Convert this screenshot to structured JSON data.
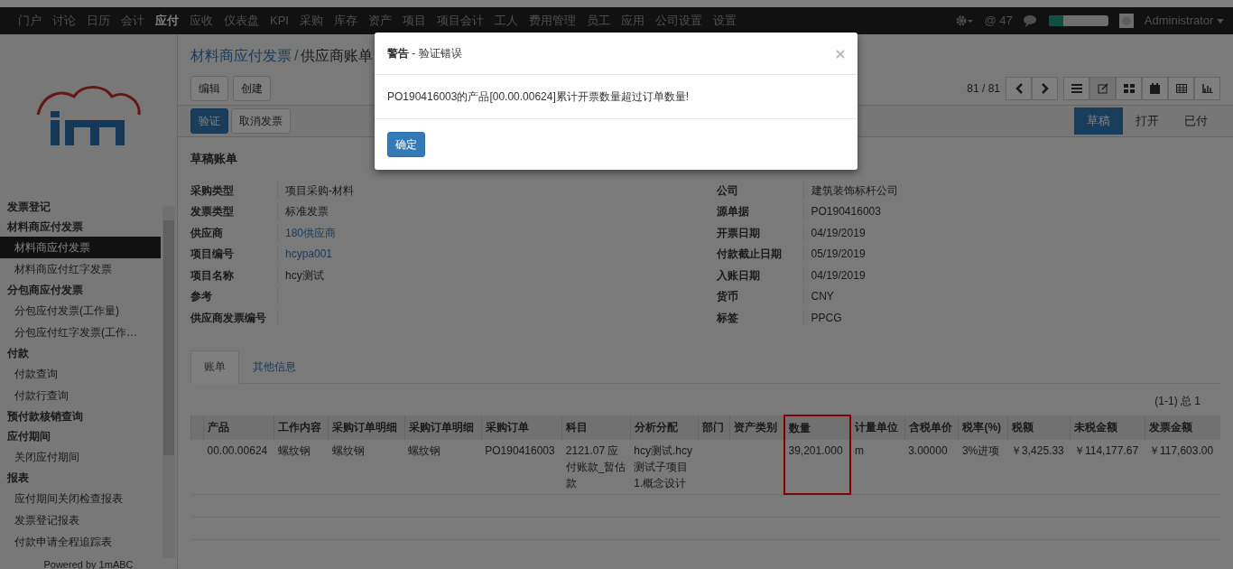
{
  "top_menu": [
    {
      "label": "门户",
      "selected": false
    },
    {
      "label": "讨论",
      "selected": false
    },
    {
      "label": "日历",
      "selected": false
    },
    {
      "label": "会计",
      "selected": false
    },
    {
      "label": "应付",
      "selected": true
    },
    {
      "label": "应收",
      "selected": false
    },
    {
      "label": "仪表盘",
      "selected": false
    },
    {
      "label": "KPI",
      "selected": false
    },
    {
      "label": "采购",
      "selected": false
    },
    {
      "label": "库存",
      "selected": false
    },
    {
      "label": "资产",
      "selected": false
    },
    {
      "label": "项目",
      "selected": false
    },
    {
      "label": "项目会计",
      "selected": false
    },
    {
      "label": "工人",
      "selected": false
    },
    {
      "label": "费用管理",
      "selected": false
    },
    {
      "label": "员工",
      "selected": false
    },
    {
      "label": "应用",
      "selected": false
    },
    {
      "label": "公司设置",
      "selected": false
    },
    {
      "label": "设置",
      "selected": false
    }
  ],
  "top_right": {
    "mentions": "@ 47",
    "progress": {
      "level": 0.25
    },
    "user": "Administrator"
  },
  "sidebar": {
    "sections": [
      {
        "title": "发票登记"
      },
      {
        "title": "材料商应付发票",
        "items": [
          {
            "label": "材料商应付发票",
            "selected": true
          },
          {
            "label": "材料商应付红字发票",
            "selected": false
          }
        ]
      },
      {
        "title": "分包商应付发票",
        "items": [
          {
            "label": "分包应付发票(工作量)",
            "selected": false
          },
          {
            "label": "分包应付红字发票(工作…",
            "selected": false
          }
        ]
      },
      {
        "title": "付款",
        "items": [
          {
            "label": "付款查询",
            "selected": false
          },
          {
            "label": "付款行查询",
            "selected": false
          }
        ]
      },
      {
        "title": "预付款核销查询"
      },
      {
        "title": "应付期间",
        "items": [
          {
            "label": "关闭应付期间",
            "selected": false
          }
        ]
      },
      {
        "title": "报表",
        "items": [
          {
            "label": "应付期间关闭检查报表",
            "selected": false
          },
          {
            "label": "发票登记报表",
            "selected": false
          },
          {
            "label": "付款申请全程追踪表",
            "selected": false
          }
        ]
      }
    ],
    "footer": "Powered by 1mABC"
  },
  "breadcrumb": {
    "items": [
      "材料商应付发票",
      "供应商账单"
    ],
    "separator": "/"
  },
  "buttons": [
    "编辑",
    "创建"
  ],
  "pager": "81 / 81",
  "action_buttons": [
    {
      "label": "验证",
      "primary": true
    },
    {
      "label": "取消发票",
      "primary": false
    }
  ],
  "status_steps": [
    {
      "label": "草稿",
      "selected": true
    },
    {
      "label": "打开",
      "selected": false
    },
    {
      "label": "已付",
      "selected": false
    }
  ],
  "form": {
    "title": "草稿账单",
    "left": [
      {
        "label": "采购类型",
        "value": "项目采购-材料",
        "link": false
      },
      {
        "label": "发票类型",
        "value": "标准发票",
        "link": false
      },
      {
        "label": "供应商",
        "value": "180供应商",
        "link": true
      },
      {
        "label": "项目编号",
        "value": "hcypa001",
        "link": true
      },
      {
        "label": "项目名称",
        "value": "hcy测试",
        "link": false
      },
      {
        "label": "参考"
      },
      {
        "label": "供应商发票编号"
      }
    ],
    "right": [
      {
        "label": "公司",
        "value": "建筑装饰标杆公司"
      },
      {
        "label": "源单据",
        "value": "PO190416003"
      },
      {
        "label": "开票日期",
        "value": "04/19/2019"
      },
      {
        "label": "付款截止日期",
        "value": "05/19/2019"
      },
      {
        "label": "入账日期",
        "value": "04/19/2019"
      },
      {
        "label": "货币",
        "value": "CNY"
      },
      {
        "label": "标签",
        "value": "PPCG"
      }
    ]
  },
  "tabs": [
    {
      "label": "账单",
      "selected": true
    },
    {
      "label": "其他信息",
      "selected": false
    }
  ],
  "table": {
    "count": "(1-1) 总 1",
    "columns": [
      {
        "label": "产品",
        "highlighted": false
      },
      {
        "label": "工作内容",
        "highlighted": false
      },
      {
        "label": "采购订单明细",
        "highlighted": false
      },
      {
        "label": "采购订单明细",
        "highlighted": false
      },
      {
        "label": "采购订单",
        "highlighted": false
      },
      {
        "label": "科目",
        "highlighted": false
      },
      {
        "label": "分析分配",
        "highlighted": false
      },
      {
        "label": "部门",
        "highlighted": false
      },
      {
        "label": "资产类别",
        "highlighted": false
      },
      {
        "label": "数量",
        "highlighted": true
      },
      {
        "label": "计量单位",
        "highlighted": false
      },
      {
        "label": "含税单价",
        "highlighted": false
      },
      {
        "label": "税率(%)",
        "highlighted": false
      },
      {
        "label": "税额",
        "highlighted": false
      },
      {
        "label": "未税金额",
        "highlighted": false
      },
      {
        "label": "发票金额",
        "highlighted": false
      }
    ],
    "rows": [
      [
        "00.00.00624",
        "螺纹钢",
        "螺纹钢",
        "螺纹钢",
        "PO190416003",
        "2121.07 应付账款_暂估款",
        "hcy测试.hcy测试子项目1.概念设计",
        "",
        "",
        "39,201.000",
        "m",
        "3.00000",
        "3%进项",
        "￥3,425.33",
        "￥114,177.67",
        "￥117,603.00"
      ]
    ]
  },
  "dialog": {
    "title": "警告",
    "subtitle": " - 验证错误",
    "message": "PO190416003的产品[00.00.00624]累计开票数量超过订单数量!",
    "button": "确定"
  }
}
